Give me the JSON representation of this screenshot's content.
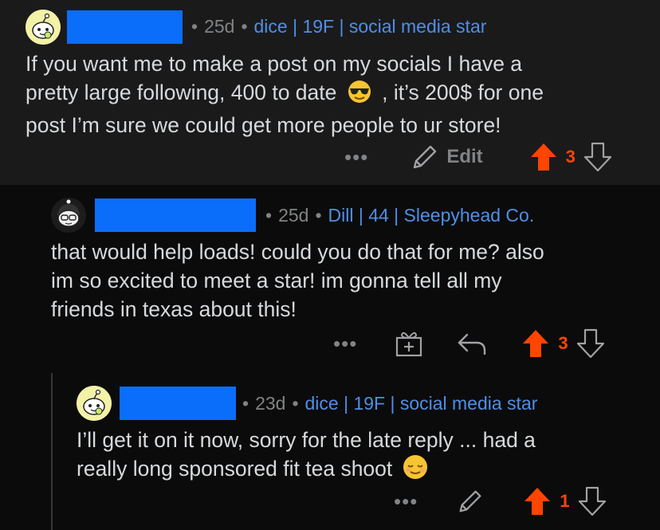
{
  "comments": [
    {
      "id": "c1",
      "timestamp": "25d",
      "flair": "dice | 19F | social media star",
      "body_lines": [
        "If you want me to make a post on my socials I have a",
        "pretty large following, 400 to date",
        ", it’s 200$ for one",
        "post I’m sure we could get more people to ur store!"
      ],
      "emoji": "sunglasses-emoji",
      "more_label": "•••",
      "edit_label": "Edit",
      "score": "3",
      "upvoted": true
    },
    {
      "id": "c2",
      "timestamp": "25d",
      "flair": "Dill | 44 | Sleepyhead Co.",
      "body_lines": [
        "that would help loads! could you do that for me? also",
        "im so excited to meet a star! im gonna tell all my",
        "friends in texas about this!"
      ],
      "more_label": "•••",
      "score": "3",
      "upvoted": true
    },
    {
      "id": "c3",
      "timestamp": "23d",
      "flair": "dice | 19F | social media star",
      "body_lines": [
        "I’ll get it on it now, sorry for the late reply ... had a",
        "really long sponsored fit tea shoot"
      ],
      "emoji": "relieved-face-emoji",
      "more_label": "•••",
      "score": "1",
      "upvoted": true
    }
  ],
  "colors": {
    "upvote": "#ff4500",
    "flair": "#4f8fe6",
    "redaction": "#0a6efb",
    "meta": "#818384",
    "card_bg": "#1a1a1b",
    "page_bg": "#0b0b0c"
  }
}
